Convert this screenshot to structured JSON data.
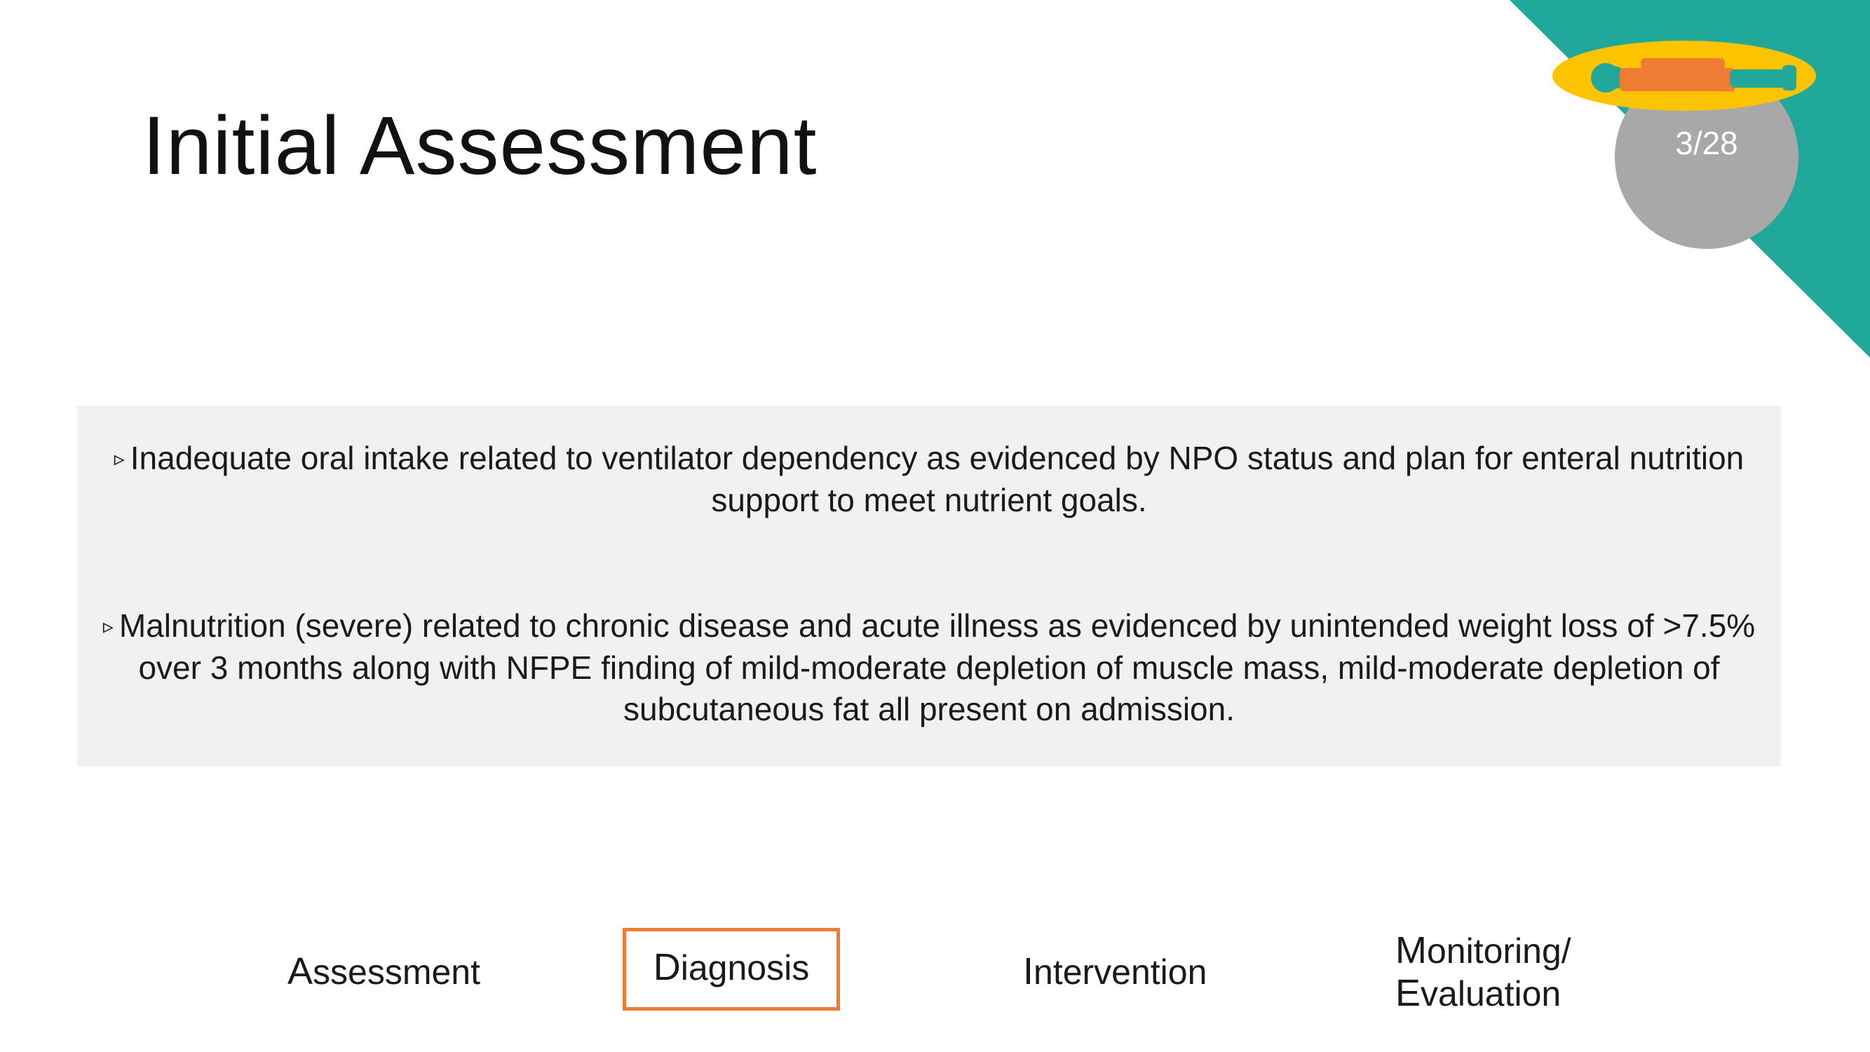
{
  "slide": {
    "title": "Initial Assessment",
    "counter": "3/28"
  },
  "diagnoses": [
    {
      "bullet": "▹",
      "text": "Inadequate oral intake related to ventilator dependency as evidenced by NPO status and plan for enteral nutrition support to meet nutrient goals."
    },
    {
      "bullet": "▹",
      "text": "Malnutrition (severe) related to chronic disease and acute illness as evidenced by unintended weight loss of >7.5% over 3 months along with NFPE finding of  mild-moderate depletion of muscle mass, mild-moderate depletion of subcutaneous fat all present on admission."
    }
  ],
  "nav": {
    "assessment": {
      "initial": "A",
      "rest": "ssessment"
    },
    "diagnosis": {
      "initial": "D",
      "rest": "iagnosis"
    },
    "intervention": {
      "initial": "I",
      "rest": "ntervention"
    },
    "monitoring": {
      "initial": "M",
      "rest": "onitoring/"
    },
    "evaluation": {
      "initial": "E",
      "rest": "valuation"
    },
    "active": "diagnosis"
  },
  "colors": {
    "teal": "#20a99a",
    "counter_gray": "#a8a8a8",
    "content_bg": "#f1f1f1",
    "active_border": "#ee7c33",
    "icon_yellow": "#fcc400",
    "icon_orange": "#ee7c33",
    "icon_teal": "#20a99a"
  },
  "icons": {
    "patient": "patient-lying-in-bed-icon"
  }
}
